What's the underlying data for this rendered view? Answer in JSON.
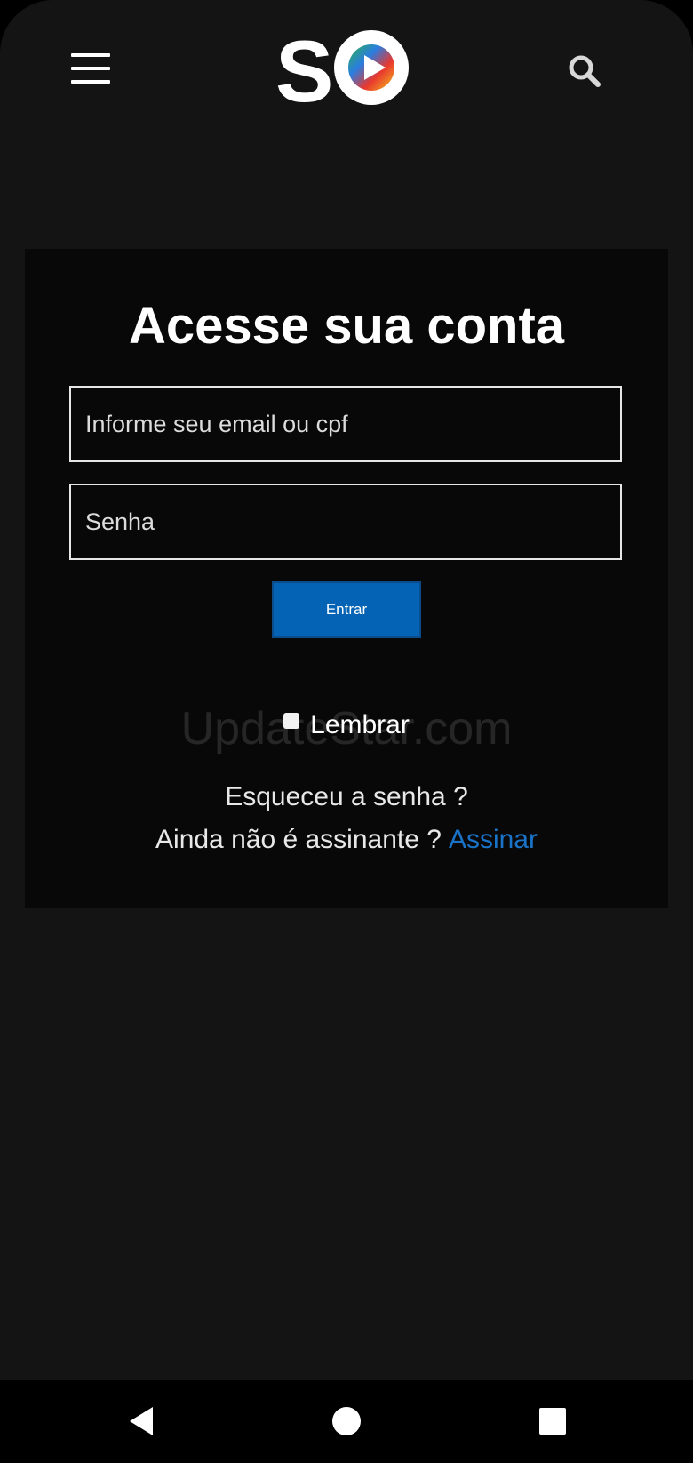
{
  "header": {
    "menu_icon": "hamburger-menu-icon",
    "logo_text": "SO",
    "search_icon": "search-icon"
  },
  "login": {
    "title": "Acesse sua conta",
    "email_placeholder": "Informe seu email ou cpf",
    "password_placeholder": "Senha",
    "submit_label": "Entrar",
    "remember_label": "Lembrar",
    "forgot_label": "Esqueceu a senha ?",
    "signup_prompt": "Ainda não é assinante ?",
    "signup_link": "Assinar"
  },
  "watermark": "UpdateStar.com",
  "colors": {
    "background": "#141414",
    "card": "#080808",
    "accent": "#0563b5",
    "link": "#1a73c7"
  },
  "android_nav": {
    "back_icon": "back-triangle-icon",
    "home_icon": "home-circle-icon",
    "recent_icon": "recent-apps-square-icon"
  }
}
